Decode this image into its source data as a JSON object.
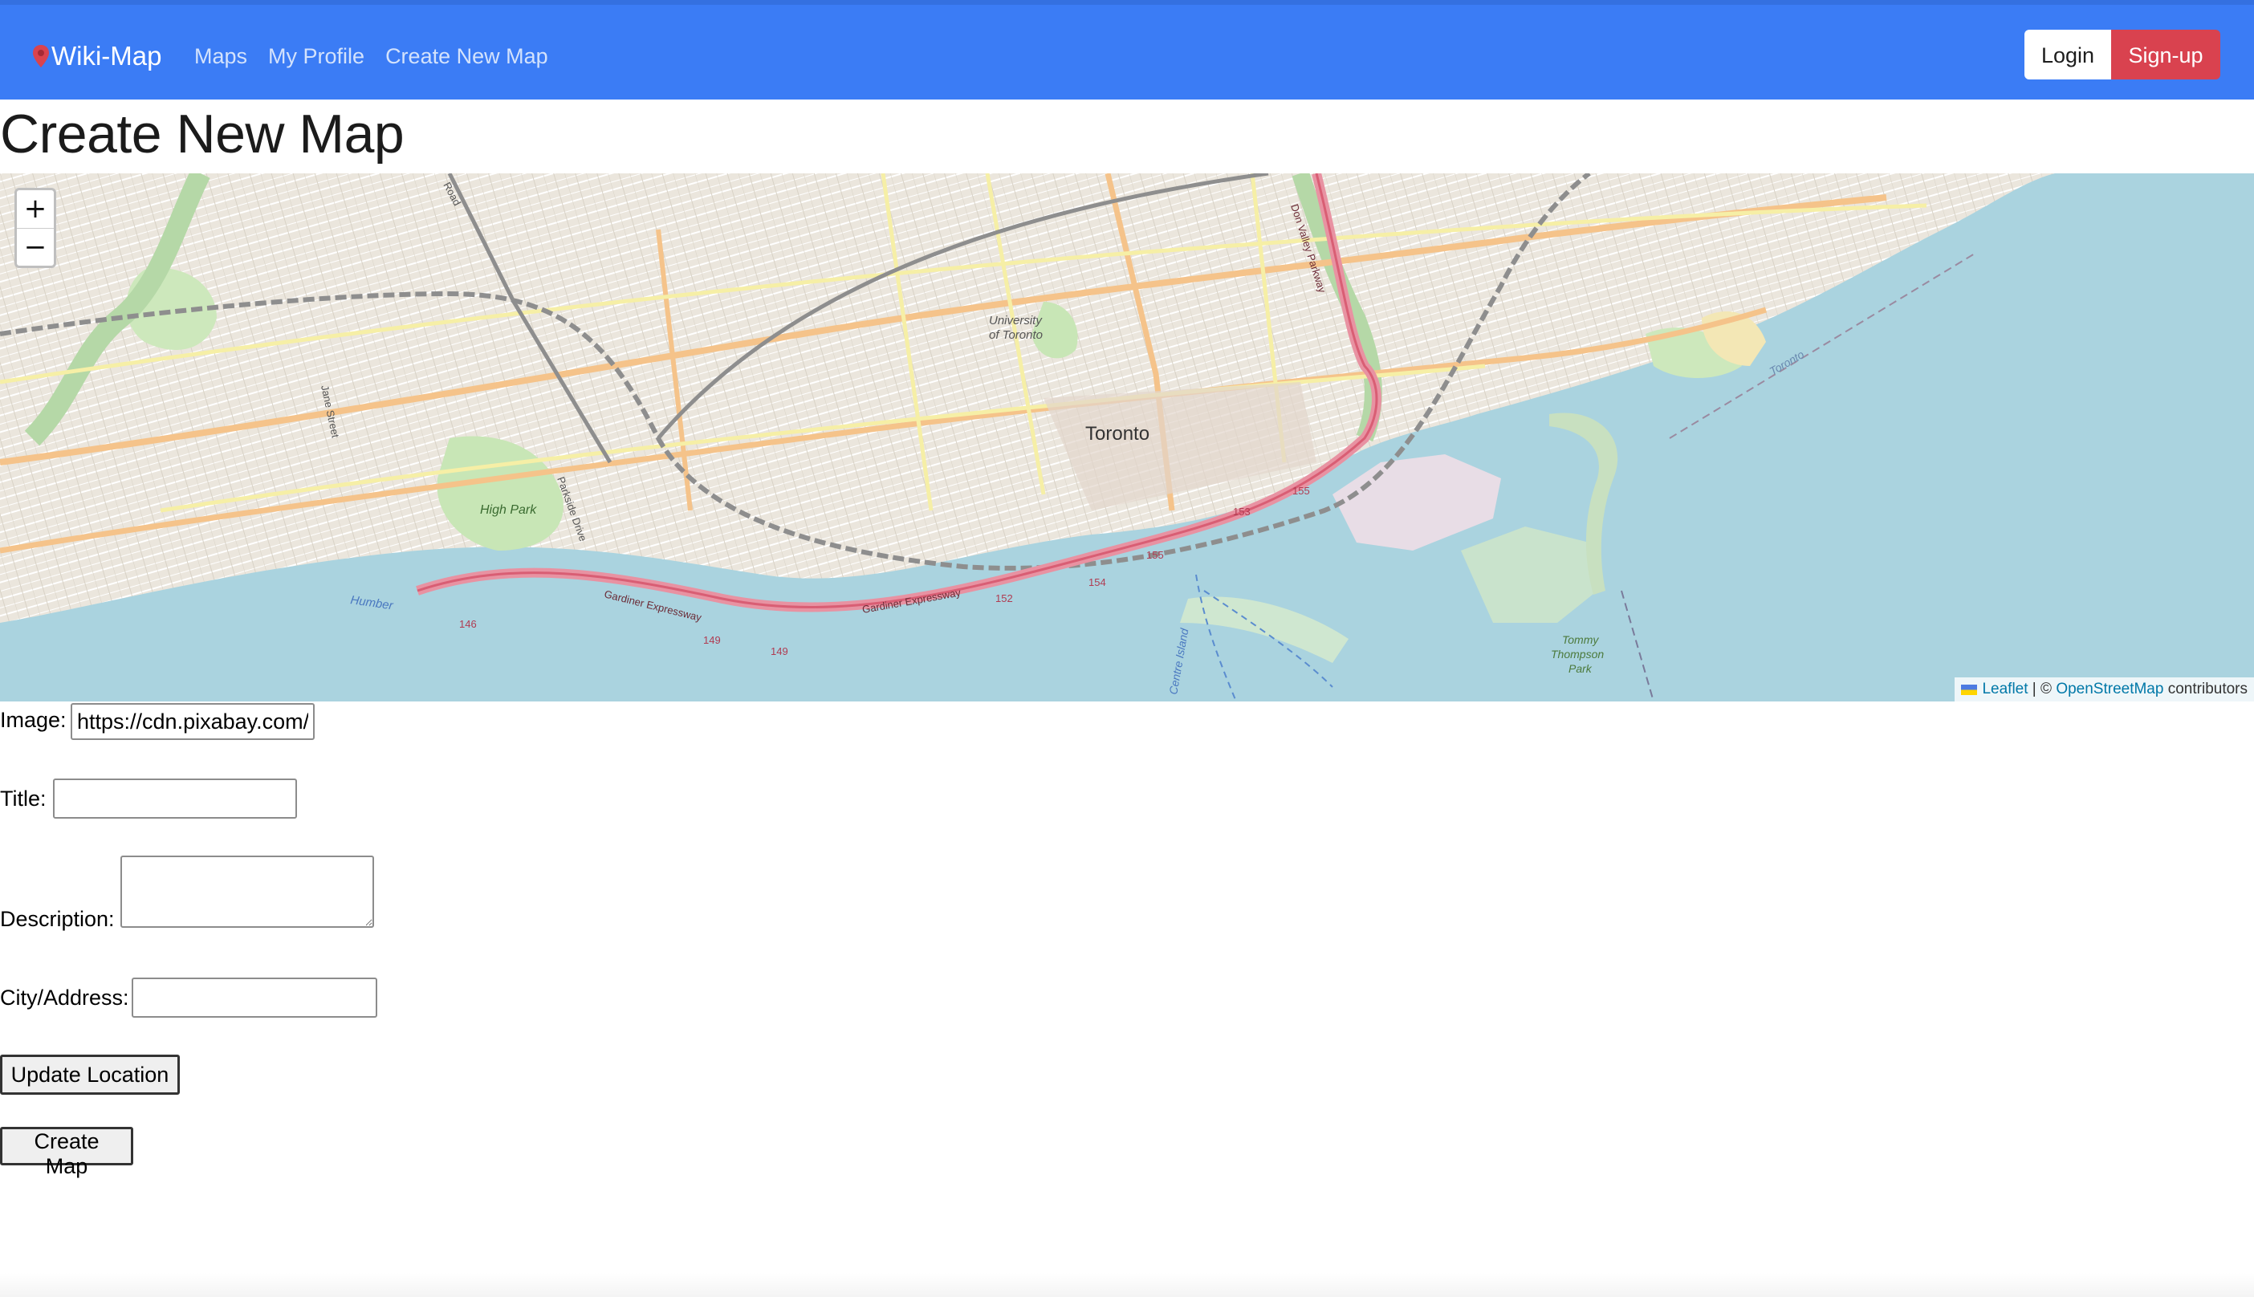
{
  "navbar": {
    "brand": "Wiki-Map",
    "links": [
      "Maps",
      "My Profile",
      "Create New Map"
    ],
    "login_label": "Login",
    "signup_label": "Sign-up",
    "colors": {
      "navbar": "#3b7cf5",
      "signup": "#d9424f"
    }
  },
  "page": {
    "title": "Create New Map"
  },
  "map": {
    "zoom_in": "+",
    "zoom_out": "−",
    "attribution": {
      "leaflet": "Leaflet",
      "separator": " | © ",
      "osm": "OpenStreetMap",
      "suffix": " contributors"
    },
    "labels": {
      "city": "Toronto",
      "university_1": "University",
      "university_2": "of Toronto",
      "high_park": "High Park",
      "jane_street": "Jane Street",
      "parkside": "Parkside Drive",
      "gardiner_1": "Gardiner Expressway",
      "gardiner_2": "Gardiner Expressway",
      "centre_island": "Centre Island",
      "tommy_1": "Tommy",
      "tommy_2": "Thompson",
      "tommy_3": "Park",
      "dvp": "Don Valley Parkway",
      "humber": "Humber",
      "toronto_water": "Toronto",
      "road": "Road",
      "rt_146": "146",
      "rt_149a": "149",
      "rt_149b": "149",
      "rt_152": "152",
      "rt_153": "153",
      "rt_154": "154",
      "rt_155a": "155",
      "rt_155b": "155"
    }
  },
  "form": {
    "image_label": "Image:",
    "image_value": "https://cdn.pixabay.com/",
    "title_label": "Title:",
    "title_value": "",
    "description_label": "Description:",
    "description_value": "",
    "address_label": "City/Address:",
    "address_value": "",
    "update_button": "Update Location",
    "create_button": "Create Map"
  }
}
